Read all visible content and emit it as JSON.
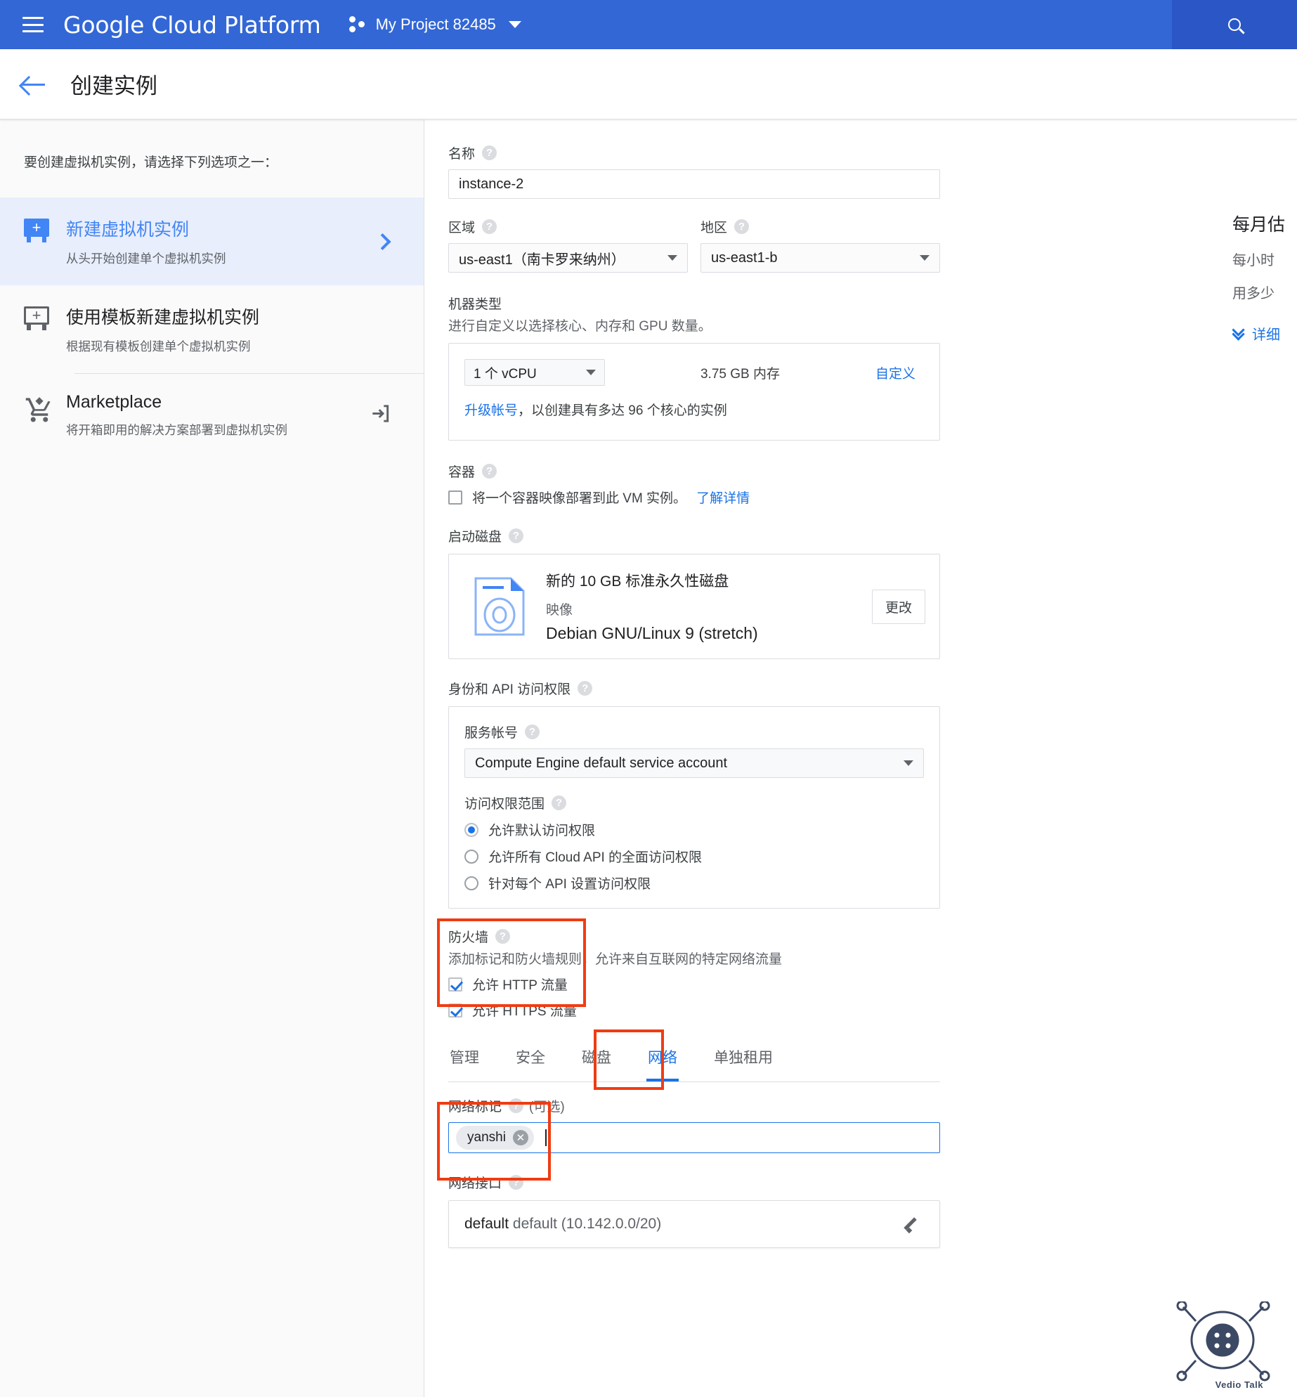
{
  "topbar": {
    "brand": "Google Cloud Platform",
    "project": "My Project 82485",
    "search_icon": "search-icon",
    "menu_icon": "hamburger-menu-icon"
  },
  "page": {
    "title": "创建实例",
    "back_icon": "back-arrow-icon"
  },
  "left_pane": {
    "lead": "要创建虚拟机实例，请选择下列选项之一：",
    "options": [
      {
        "title": "新建虚拟机实例",
        "sub": "从头开始创建单个虚拟机实例",
        "selected": true,
        "icon": "vm-add-filled-icon"
      },
      {
        "title": "使用模板新建虚拟机实例",
        "sub": "根据现有模板创建单个虚拟机实例",
        "selected": false,
        "icon": "vm-add-outline-icon"
      },
      {
        "title": "Marketplace",
        "sub": "将开箱即用的解决方案部署到虚拟机实例",
        "selected": false,
        "icon": "shopping-cart-icon"
      }
    ]
  },
  "form": {
    "name": {
      "label": "名称",
      "value": "instance-2"
    },
    "region": {
      "label": "区域",
      "value": "us-east1（南卡罗来纳州）"
    },
    "zone": {
      "label": "地区",
      "value": "us-east1-b"
    },
    "machine_type": {
      "label": "机器类型",
      "sub": "进行自定义以选择核心、内存和 GPU 数量。",
      "cpu": "1 个 vCPU",
      "memory": "3.75 GB 内存",
      "customize": "自定义",
      "note_link": "升级帐号",
      "note_rest": "，以创建具有多达 96 个核心的实例"
    },
    "container": {
      "label": "容器",
      "text": "将一个容器映像部署到此 VM 实例。",
      "link": "了解详情",
      "checked": false
    },
    "boot_disk": {
      "label": "启动磁盘",
      "disk": "新的 10 GB 标准永久性磁盘",
      "image_label": "映像",
      "image": "Debian GNU/Linux 9 (stretch)",
      "change_button": "更改"
    },
    "identity": {
      "label": "身份和 API 访问权限",
      "service_account_label": "服务帐号",
      "service_account": "Compute Engine default service account",
      "scopes_label": "访问权限范围",
      "scopes": [
        {
          "label": "允许默认访问权限",
          "selected": true
        },
        {
          "label": "允许所有 Cloud API 的全面访问权限",
          "selected": false
        },
        {
          "label": "针对每个 API 设置访问权限",
          "selected": false
        }
      ]
    },
    "firewall": {
      "label": "防火墙",
      "sub": "添加标记和防火墙规则，允许来自互联网的特定网络流量",
      "http": {
        "label": "允许 HTTP 流量",
        "checked": true
      },
      "https": {
        "label": "允许 HTTPS 流量",
        "checked": true
      }
    },
    "tabs": [
      {
        "label": "管理",
        "active": false
      },
      {
        "label": "安全",
        "active": false
      },
      {
        "label": "磁盘",
        "active": false
      },
      {
        "label": "网络",
        "active": true
      },
      {
        "label": "单独租用",
        "active": false
      }
    ],
    "network_tags": {
      "label": "网络标记",
      "optional": "(可选)",
      "chips": [
        "yanshi"
      ]
    },
    "network_interface": {
      "label": "网络接口",
      "name": "default",
      "detail": "default (10.142.0.0/20)",
      "edit_icon": "pencil-edit-icon"
    }
  },
  "price_pane": {
    "title": "每月估",
    "line1": "每小时",
    "line2": "用多少",
    "details": "详细"
  },
  "watermark": {
    "text": "Vedio Talk"
  },
  "colors": {
    "brand_blue": "#3367d6",
    "link_blue": "#1a73e8",
    "highlight_red": "#f03c12",
    "selected_bg": "#e8eefc"
  }
}
